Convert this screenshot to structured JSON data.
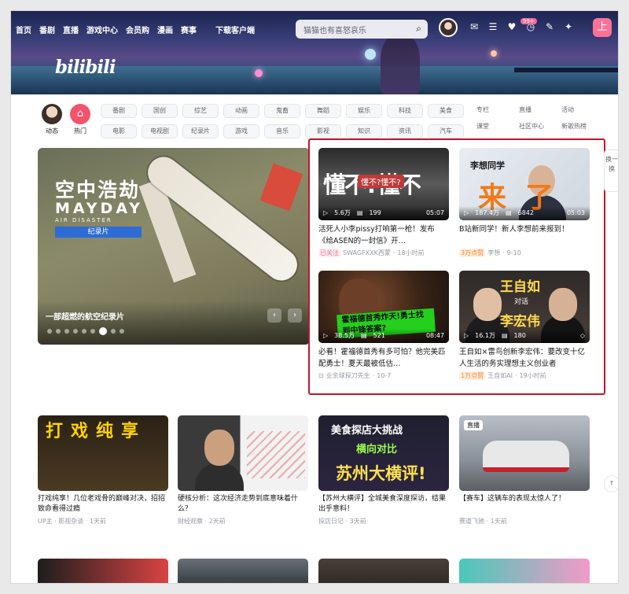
{
  "topnav": {
    "items": [
      "首页",
      "番剧",
      "直播",
      "游戏中心",
      "会员购",
      "漫画",
      "赛事"
    ],
    "download": "下载客户端",
    "search_placeholder": "猫猫也有喜怒哀乐",
    "icons": [
      "message-icon",
      "dynamic-icon",
      "favorite-icon",
      "history-icon",
      "creation-icon"
    ],
    "badge": "99+",
    "upload_label": "上"
  },
  "logo_text": "bilibili",
  "channels_left": [
    {
      "label": "动态",
      "color": "#f1d6c3"
    },
    {
      "label": "热门",
      "color": "#f4536a"
    }
  ],
  "channels": [
    "番剧",
    "国创",
    "综艺",
    "动画",
    "鬼畜",
    "舞蹈",
    "娱乐",
    "科技",
    "美食",
    "电影",
    "电视剧",
    "纪录片",
    "游戏",
    "音乐",
    "影视",
    "知识",
    "资讯",
    "汽车"
  ],
  "channels_right": [
    "专栏",
    "直播",
    "活动",
    "课堂",
    "社区中心",
    "新歌热榜"
  ],
  "hero": {
    "title": "空中浩劫",
    "subtitle": "MAYDAY",
    "sub2": "AIR DISASTER",
    "tag": "纪录片",
    "caption": "一部超燃的航空纪录片",
    "arrows": [
      "‹",
      "›"
    ]
  },
  "feed": [
    {
      "views": "5.6万",
      "danmaku": "199",
      "duration": "05:07",
      "title": "活死人小李pissy打响第一枪！发布《给ASEN的一封信》开…",
      "tag": "已关注",
      "uploader": "SWAGFXXK西蒙",
      "time": "18小时前",
      "thumb_text": "懂不?懂不",
      "thumb_pill": "懂不?懂不?"
    },
    {
      "views": "187.4万",
      "danmaku": "6842",
      "duration": "05:03",
      "title": "B站新同学！新人李想前来报到！",
      "tag": "3万点赞",
      "uploader": "李想",
      "time": "9-10",
      "thumb_head": "李想同学",
      "thumb_big": "来了"
    },
    {
      "views": "38.5万",
      "danmaku": "521",
      "duration": "08:47",
      "title": "必看！霍福德首秀有多可怕？他完美匹配勇士！夏天最被低估…",
      "tag": "",
      "uploader": "业余球探刀先生",
      "time": "10-7",
      "thumb_banner": "霍福德首秀炸天!勇士找到中锋答案?"
    },
    {
      "views": "16.1万",
      "danmaku": "180",
      "duration": "",
      "title": "王自如×雷鸟创新李宏伟：要改变十亿人生活的务实理想主义创业者",
      "tag": "1万点赞",
      "uploader": "王自如AI",
      "time": "19小时前",
      "thumb_n1": "王自如",
      "thumb_n2": "对话",
      "thumb_n3": "李宏伟"
    }
  ],
  "bottom": [
    {
      "title": "打戏纯享！几位老戏骨的巅峰对决，招招致命看得过瘾",
      "meta": "UP主 · 影视杂谈 · 1天前",
      "thumb_text": "打戏纯享"
    },
    {
      "title": "硬核分析：这次经济走势到底意味着什么？",
      "meta": "财经观察 · 2天前"
    },
    {
      "title": "【苏州大横评】全城美食深度探访，结果出乎意料！",
      "meta": "探店日记 · 3天前",
      "l1": "美食探店大挑战",
      "l2": "横向对比",
      "l3": "苏州大横评!"
    },
    {
      "title": "【赛车】这辆车的表现太惊人了！",
      "meta": "赛道飞驰 · 1天前",
      "tag": "直播"
    }
  ],
  "side_buttons": [
    "换一换",
    "顶部"
  ]
}
